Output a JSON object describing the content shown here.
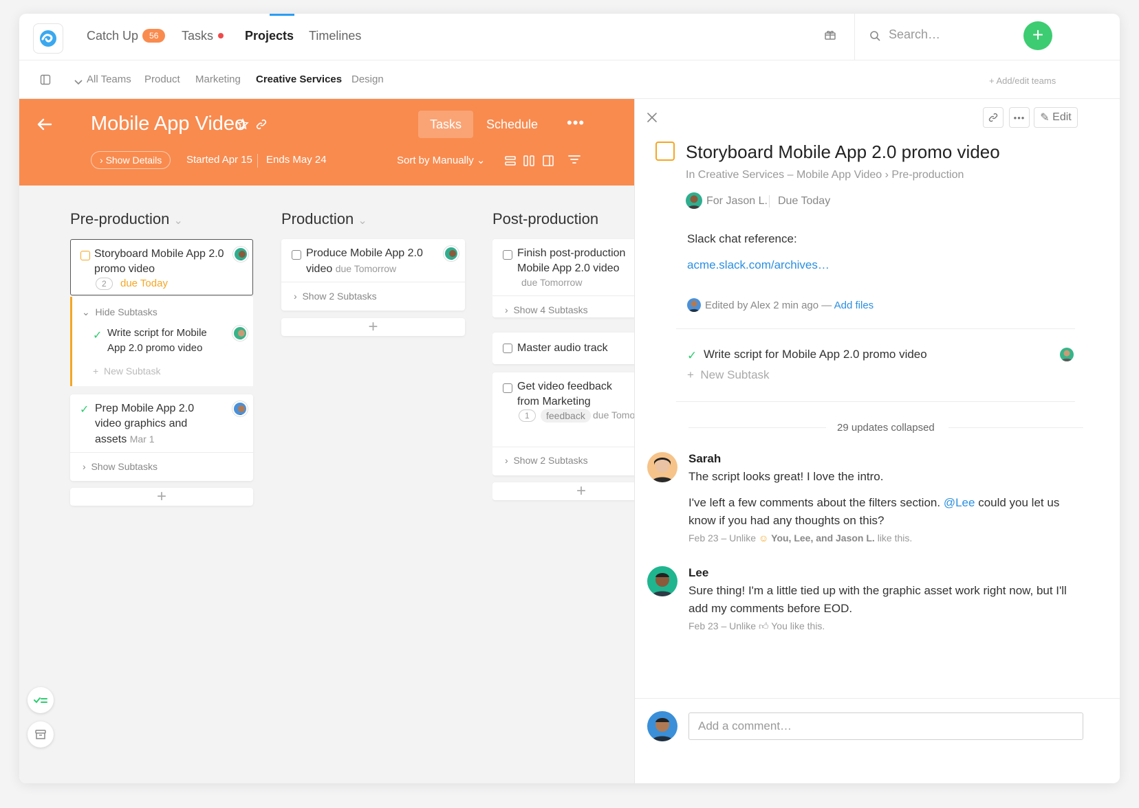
{
  "topnav": {
    "catchup": {
      "label": "Catch Up",
      "badge": "56"
    },
    "tasks": "Tasks",
    "projects": "Projects",
    "timelines": "Timelines",
    "search_placeholder": "Search…"
  },
  "teams": {
    "items": [
      "All Teams",
      "Product",
      "Marketing",
      "Creative Services",
      "Design"
    ],
    "active": "Creative Services",
    "add_edit": "+ Add/edit teams"
  },
  "project": {
    "title": "Mobile App Video",
    "show_details": "Show Details",
    "started": "Started Apr 15",
    "ends": "Ends May 24",
    "tab_tasks": "Tasks",
    "tab_schedule": "Schedule",
    "sort": "Sort by Manually"
  },
  "columns": [
    {
      "title": "Pre-production",
      "cards": [
        {
          "title": "Storyboard Mobile App 2.0 promo video",
          "comment_count": "2",
          "due": "due Today",
          "hide_subtasks": "Hide Subtasks",
          "subtask": "Write script for Mobile App 2.0 promo video",
          "new_subtask": "New Subtask"
        },
        {
          "title": "Prep Mobile App 2.0 video graphics and assets",
          "due": "Mar 1",
          "show_subtasks": "Show Subtasks"
        }
      ]
    },
    {
      "title": "Production",
      "cards": [
        {
          "title": "Produce Mobile App 2.0 video",
          "due": "due Tomorrow",
          "show_subtasks": "Show 2 Subtasks"
        }
      ]
    },
    {
      "title": "Post-production",
      "cards": [
        {
          "title": "Finish post-production Mobile App 2.0 video",
          "due": "due Tomorrow",
          "show_subtasks": "Show 4 Subtasks"
        },
        {
          "title": "Master audio track"
        },
        {
          "title": "Get video feedback from Marketing",
          "comment_count": "1",
          "tag": "feedback",
          "due": "due Tomorrow",
          "show_subtasks": "Show 2 Subtasks"
        }
      ]
    }
  ],
  "detail": {
    "edit": "Edit",
    "title": "Storyboard Mobile App 2.0 promo video",
    "breadcrumb": "In Creative Services – Mobile App Video › Pre-production",
    "for": "For Jason L.",
    "due": "Due Today",
    "desc_label": "Slack chat reference:",
    "desc_link": "acme.slack.com/archives…",
    "edited_by": "Edited by Alex 2 min ago —",
    "add_files": "Add files",
    "subtask": "Write script for Mobile App 2.0 promo video",
    "new_subtask": "New Subtask",
    "collapsed": "29 updates collapsed",
    "comments": [
      {
        "author": "Sarah",
        "p1": "The script looks great! I love the intro.",
        "p2a": "I've left a few comments about the filters section.",
        "mention": "@Lee",
        "p2b": "could you let us know if you had any thoughts on this?",
        "meta": "Feb 23 – Unlike",
        "likes_bold": "You, Lee, and Jason L.",
        "likes_tail": "like this."
      },
      {
        "author": "Lee",
        "p1": "Sure thing! I'm a little tied up with the graphic asset work right now, but I'll add my comments before EOD.",
        "meta": "Feb 23 – Unlike",
        "likes": "You like this."
      }
    ],
    "comment_placeholder": "Add a comment…"
  },
  "colors": {
    "accent": "#f98b4f",
    "link": "#2a8fe0",
    "success": "#2ecc71",
    "badge": "#f98b4f"
  }
}
